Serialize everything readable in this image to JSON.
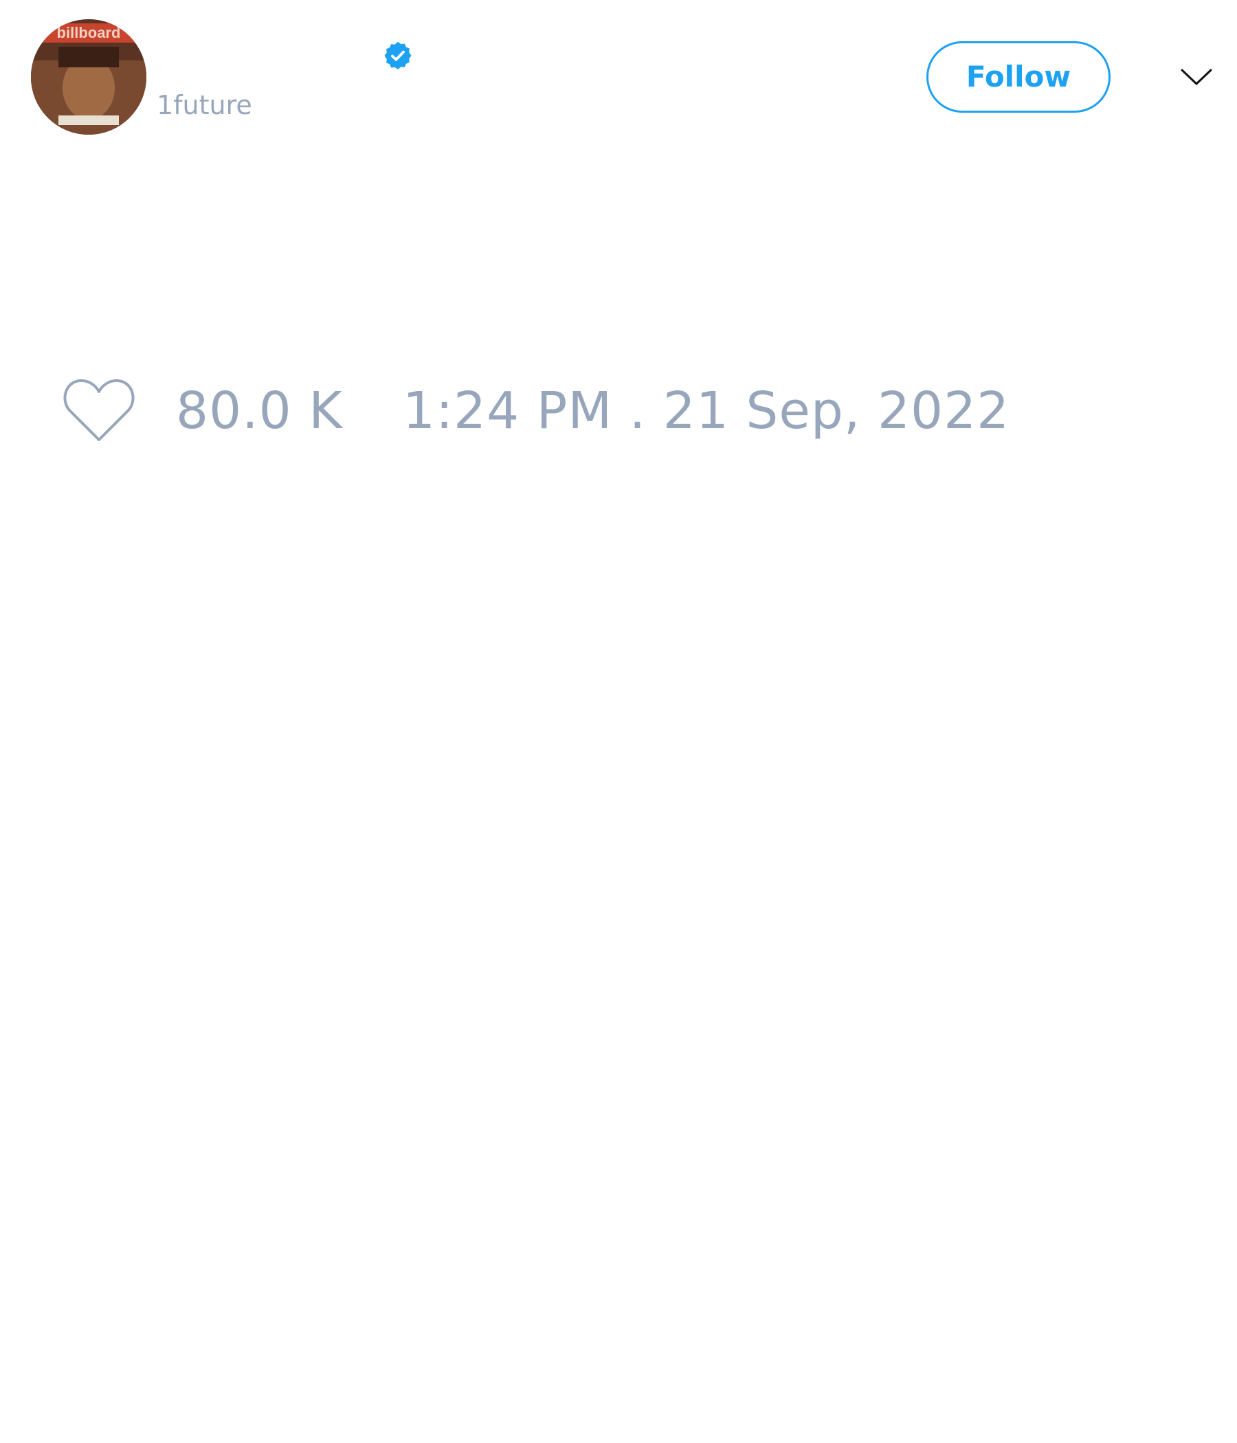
{
  "tweet": {
    "author": {
      "handle": "1future",
      "verified": true,
      "avatar_logo_text": "billboard"
    },
    "follow_label": "Follow",
    "likes": "80.0 K",
    "timestamp": "1:24 PM . 21 Sep, 2022"
  },
  "icons": {
    "verified": "verified-badge-icon",
    "menu": "chevron-down-icon",
    "like": "heart-outline-icon"
  },
  "colors": {
    "accent": "#1da1f2",
    "muted_text": "#98a6bb",
    "background": "#ffffff"
  }
}
